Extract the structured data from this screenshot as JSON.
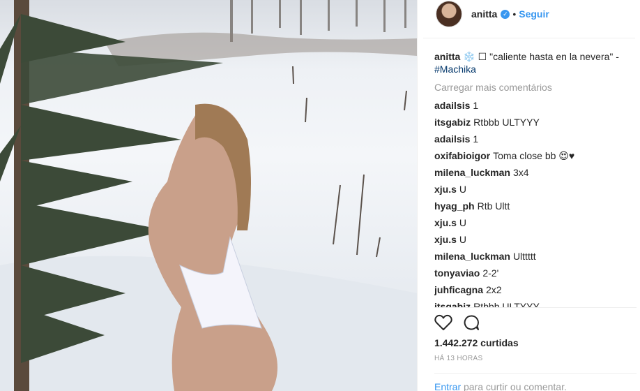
{
  "post": {
    "username": "anitta",
    "follow_label": "Seguir",
    "dot": "•",
    "caption": {
      "username": "anitta",
      "text": "❄️ ☐ \"caliente hasta en la nevera\" -",
      "hashtag": "#Machika"
    },
    "load_more": "Carregar mais comentários",
    "comments": [
      {
        "user": "adailsis",
        "text": "1"
      },
      {
        "user": "itsgabiz",
        "text": "Rtbbb ULTYYY"
      },
      {
        "user": "adailsis",
        "text": "1"
      },
      {
        "user": "oxifabioigor",
        "text": "Toma close bb 😍♥"
      },
      {
        "user": "milena_luckman",
        "text": "3x4"
      },
      {
        "user": "xju.s",
        "text": "U"
      },
      {
        "user": "hyag_ph",
        "text": "Rtb Ultt"
      },
      {
        "user": "xju.s",
        "text": "U"
      },
      {
        "user": "xju.s",
        "text": "U"
      },
      {
        "user": "milena_luckman",
        "text": "Ulttttt"
      },
      {
        "user": "tonyaviao",
        "text": "2-2'"
      },
      {
        "user": "juhficagna",
        "text": "2x2"
      },
      {
        "user": "itsgabiz",
        "text": "Rtbbb ULTYYY"
      }
    ],
    "likes": "1.442.272 curtidas",
    "time": "HÁ 13 HORAS",
    "login": {
      "link": "Entrar",
      "text": " para curtir ou comentar."
    }
  },
  "icons": {
    "verified": "✓",
    "like": "heart-icon",
    "comment": "comment-icon"
  },
  "colors": {
    "link": "#3897f0",
    "muted": "#999999",
    "text": "#262626"
  }
}
